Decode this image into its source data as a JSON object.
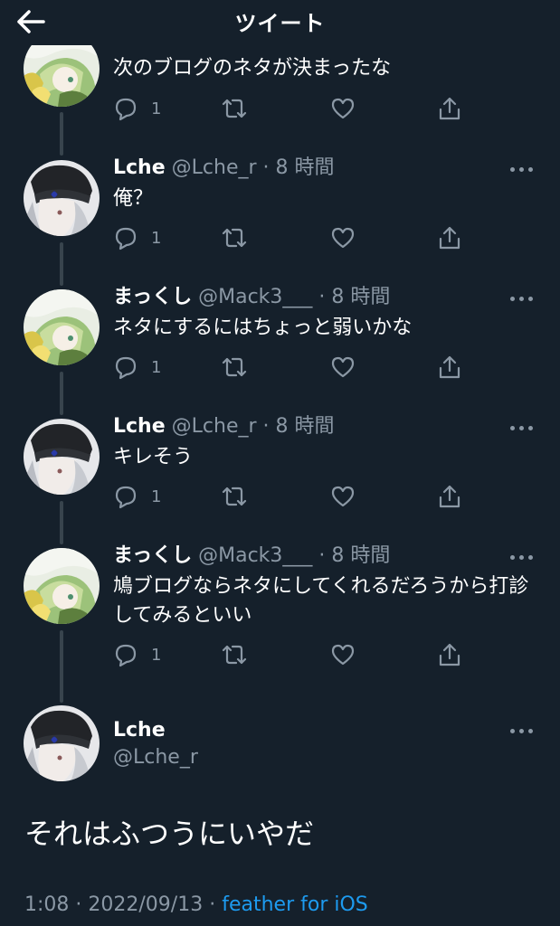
{
  "header": {
    "title": "ツイート",
    "back_icon": "arrow-left-icon"
  },
  "colors": {
    "background": "#15202b",
    "secondary_text": "#8b98a5",
    "link": "#1d9bf0",
    "thread_line": "#38444d"
  },
  "replies": [
    {
      "avatar": "avatar-green-hair",
      "text": "次のブログのネタが決まったな",
      "reply_count": "1"
    },
    {
      "avatar": "avatar-black-cap",
      "name": "Lche",
      "handle": "@Lche_r",
      "time": "· 8 時間",
      "text": "俺？",
      "reply_count": "1"
    },
    {
      "avatar": "avatar-green-hair",
      "name": "まっくし",
      "handle": "@Mack3___",
      "time": "· 8 時間",
      "text": "ネタにするにはちょっと弱いかな",
      "reply_count": "1"
    },
    {
      "avatar": "avatar-black-cap",
      "name": "Lche",
      "handle": "@Lche_r",
      "time": "· 8 時間",
      "text": "キレそう",
      "reply_count": "1"
    },
    {
      "avatar": "avatar-green-hair",
      "name": "まっくし",
      "handle": "@Mack3___",
      "time": "· 8 時間",
      "text": "鳩ブログならネタにしてくれるだろうから打診してみるといい",
      "reply_count": "1"
    }
  ],
  "main_tweet": {
    "avatar": "avatar-black-cap",
    "name": "Lche",
    "handle": "@Lche_r",
    "text": "それはふつうにいやだ",
    "time": "1:08",
    "date": "2022/09/13",
    "separator": "·",
    "source": "feather for iOS"
  }
}
